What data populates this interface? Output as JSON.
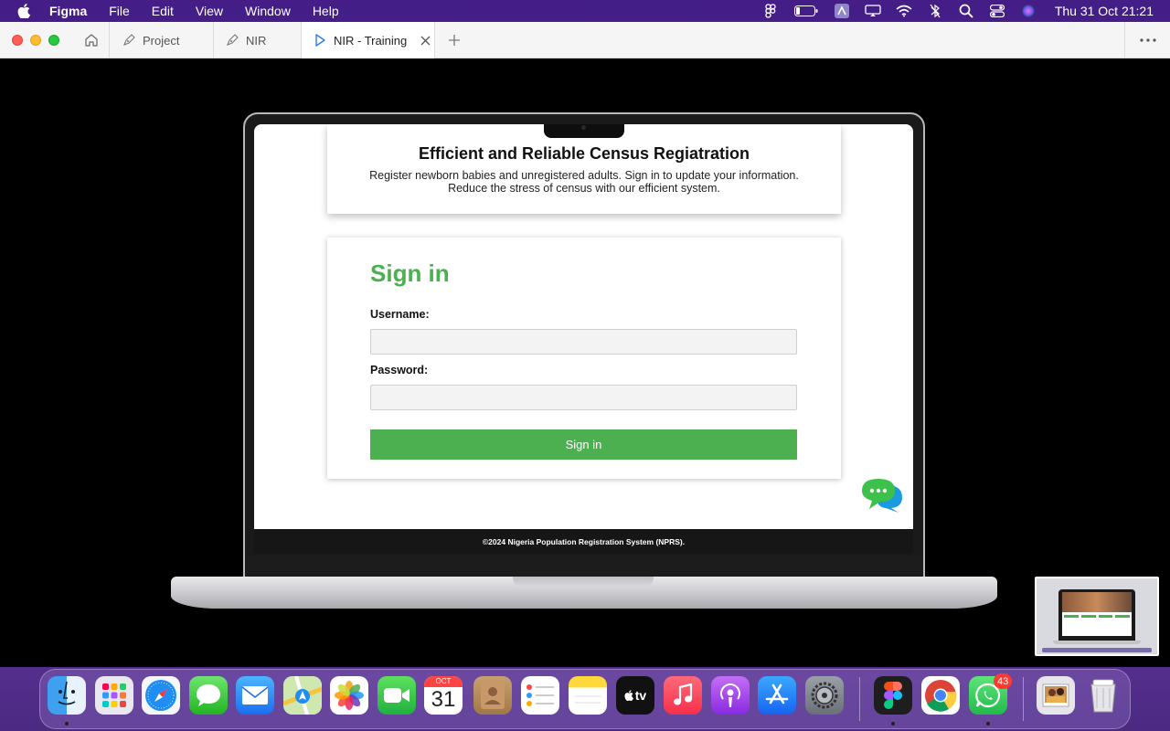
{
  "menubar": {
    "app_name": "Figma",
    "menus": [
      "File",
      "Edit",
      "View",
      "Window",
      "Help"
    ],
    "clock": "Thu 31 Oct  21:21"
  },
  "figma": {
    "tabs": [
      {
        "label": "Project",
        "active": false
      },
      {
        "label": "NIR",
        "active": false
      },
      {
        "label": "NIR - Training",
        "active": true
      }
    ]
  },
  "website": {
    "hero": {
      "title": "Efficient and Reliable Census Regiatration",
      "subtitle": "Register newborn babies and unregistered adults. Sign in to update your information. Reduce the stress of census with our efficient system."
    },
    "signin": {
      "title": "Sign in",
      "username_label": "Username:",
      "username_value": "",
      "password_label": "Password:",
      "password_value": "",
      "button_label": "Sign in"
    },
    "footer": "©2024 Nigeria Population Registration System (NPRS)."
  },
  "dock": {
    "calendar_month": "OCT",
    "calendar_day": "31",
    "whatsapp_badge": "43",
    "tv_label": "tv"
  },
  "colors": {
    "brand_green": "#4caf50",
    "menubar_bg": "#461e8c",
    "badge_red": "#ff3b30"
  }
}
